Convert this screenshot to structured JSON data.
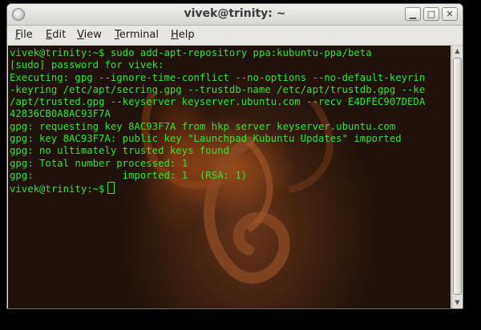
{
  "window": {
    "title": "vivek@trinity: ~",
    "minimize_glyph": "▁",
    "maximize_glyph": "□",
    "close_glyph": "✕"
  },
  "menubar": {
    "items": [
      {
        "accel": "F",
        "rest": "ile"
      },
      {
        "accel": "E",
        "rest": "dit"
      },
      {
        "accel": "V",
        "rest": "iew"
      },
      {
        "accel": "T",
        "rest": "erminal"
      },
      {
        "accel": "H",
        "rest": "elp"
      }
    ]
  },
  "terminal": {
    "text_color": "#2ee62e",
    "lines": [
      "vivek@trinity:~$ sudo add-apt-repository ppa:kubuntu-ppa/beta",
      "[sudo] password for vivek:",
      "Executing: gpg --ignore-time-conflict --no-options --no-default-keyrin",
      "-keyring /etc/apt/secring.gpg --trustdb-name /etc/apt/trustdb.gpg --ke",
      "/apt/trusted.gpg --keyserver keyserver.ubuntu.com --recv E4DFEC907DEDA",
      "42836CB0A8AC93F7A",
      "gpg: requesting key 8AC93F7A from hkp server keyserver.ubuntu.com",
      "gpg: key 8AC93F7A: public key \"Launchpad Kubuntu Updates\" imported",
      "gpg: no ultimately trusted keys found",
      "gpg: Total number processed: 1",
      "gpg:               imported: 1  (RSA: 1)"
    ],
    "prompt": "vivek@trinity:~$"
  },
  "scrollbar": {
    "up_glyph": "▲",
    "down_glyph": "▼"
  }
}
